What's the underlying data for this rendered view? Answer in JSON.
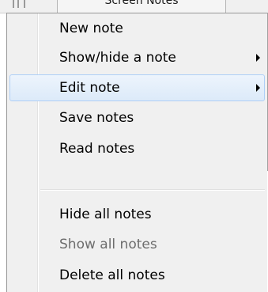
{
  "background_window": {
    "title": "Screen Notes"
  },
  "menu": {
    "items": [
      {
        "label": "New note",
        "submenu": false,
        "disabled": false,
        "highlighted": false
      },
      {
        "label": "Show/hide a note",
        "submenu": true,
        "disabled": false,
        "highlighted": false
      },
      {
        "label": "Edit note",
        "submenu": true,
        "disabled": false,
        "highlighted": true
      },
      {
        "label": "Save notes",
        "submenu": false,
        "disabled": false,
        "highlighted": false
      },
      {
        "label": "Read notes",
        "submenu": false,
        "disabled": false,
        "highlighted": false
      },
      {
        "label": "Hide all notes",
        "submenu": false,
        "disabled": false,
        "highlighted": false
      },
      {
        "label": "Show all notes",
        "submenu": false,
        "disabled": true,
        "highlighted": false
      },
      {
        "label": "Delete all notes",
        "submenu": false,
        "disabled": false,
        "highlighted": false
      }
    ]
  },
  "colors": {
    "menu_background": "#f0f0f0",
    "highlight_border": "#aecff7",
    "highlight_fill": "#dceaf9",
    "disabled_text": "#6d6d6d"
  }
}
